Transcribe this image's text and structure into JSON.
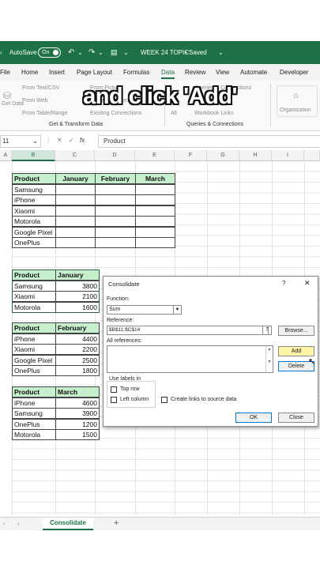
{
  "overlay_caption": "and click 'Add'",
  "titlebar": {
    "autosave_label": "AutoSave",
    "autosave_state": "On",
    "save_icon": "save-icon",
    "undo_icon": "undo-icon",
    "redo_icon": "redo-icon",
    "document_title": "WEEK 24 TOPIC",
    "save_status": "• Saved",
    "accent_color": "#1e7145"
  },
  "menu": {
    "items": [
      "File",
      "Home",
      "Insert",
      "Page Layout",
      "Formulas",
      "Data",
      "Review",
      "View",
      "Automate",
      "Developer"
    ],
    "active": "Data"
  },
  "ribbon": {
    "get_data": "Get Data",
    "from_text_csv": "From Text/CSV",
    "from_web": "From Web",
    "from_table_range": "From Table/Range",
    "from_picture": "From Picture",
    "recent_sources": "Recent Sources",
    "existing_connections": "Existing Connections",
    "refresh_all": "All",
    "queries_connections": "Queries & Connections",
    "properties": "Properties",
    "workbook_links": "Workbook Links",
    "group_get_transform": "Get & Transform Data",
    "group_queries": "Queries & Connections",
    "organization": "Organization"
  },
  "formula_bar": {
    "name_box": "11",
    "cancel_icon": "close-icon",
    "enter_icon": "check-icon",
    "fx_label": "fx",
    "formula": "Product"
  },
  "columns": [
    "A",
    "B",
    "C",
    "D",
    "E",
    "F",
    "G",
    "H",
    "I"
  ],
  "selected_column": "B",
  "table_main": {
    "headers": [
      "Product",
      "January",
      "February",
      "March"
    ],
    "rows": [
      "Samsung",
      "iPhone",
      "Xiaomi",
      "Motorola",
      "Google Pixel",
      "OnePlus"
    ]
  },
  "table_january": {
    "headers": [
      "Product",
      "January"
    ],
    "rows": [
      [
        "Samsung",
        "3800"
      ],
      [
        "Xiaomi",
        "2100"
      ],
      [
        "Motorola",
        "1600"
      ]
    ]
  },
  "table_february": {
    "headers": [
      "Product",
      "February"
    ],
    "rows": [
      [
        "iPhone",
        "4400"
      ],
      [
        "Xiaomi",
        "2200"
      ],
      [
        "Google Pixel",
        "2500"
      ],
      [
        "OnePlus",
        "1800"
      ]
    ]
  },
  "table_march": {
    "headers": [
      "Product",
      "March"
    ],
    "rows": [
      [
        "iPhone",
        "4600"
      ],
      [
        "Samsung",
        "3900"
      ],
      [
        "OnePlus",
        "1200"
      ],
      [
        "Motorola",
        "1500"
      ]
    ]
  },
  "dialog": {
    "title": "Consolidate",
    "help": "?",
    "close": "✕",
    "function_label": "Function:",
    "function_value": "Sum",
    "reference_label": "Reference:",
    "reference_value": "$B$11:$C$14",
    "browse_label": "Browse...",
    "all_references_label": "All references:",
    "add_label": "Add",
    "delete_label": "Delete",
    "use_labels_in": "Use labels in",
    "top_row": "Top row",
    "left_column": "Left column",
    "create_links": "Create links to source data",
    "ok_label": "OK",
    "cancel_label": "Close"
  },
  "sheet_tabs": {
    "active": "Consolidate",
    "add": "+"
  }
}
